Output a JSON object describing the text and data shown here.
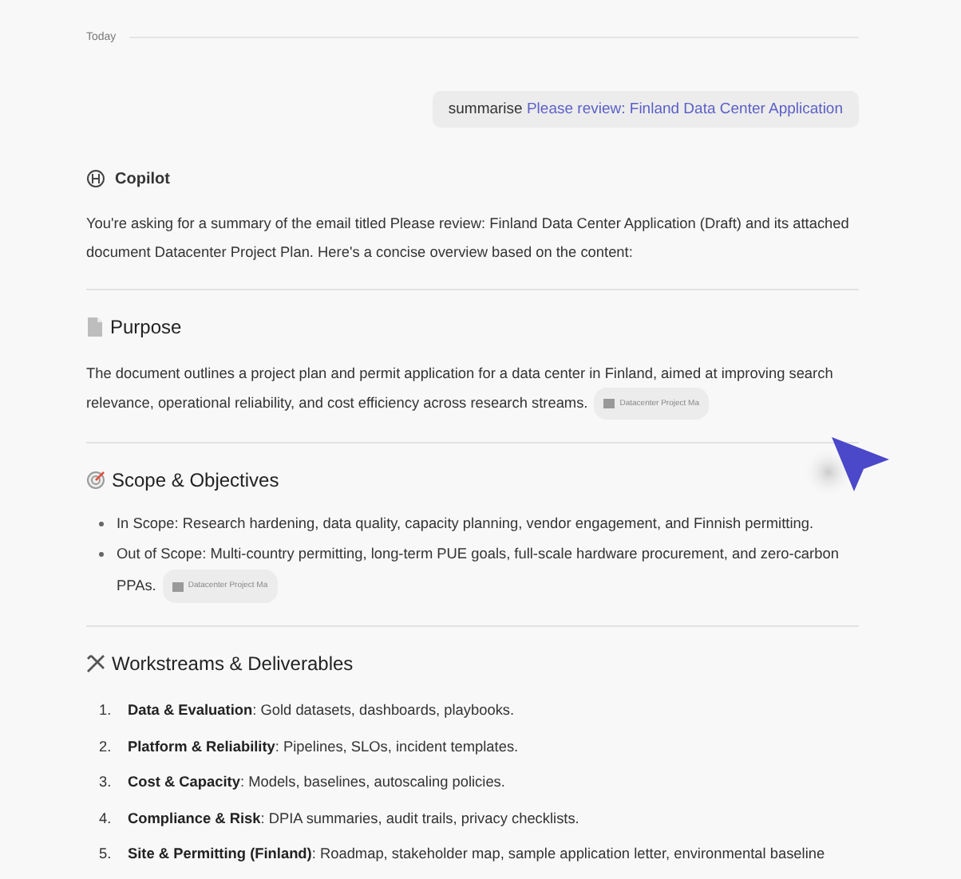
{
  "date_divider": "Today",
  "user_message": {
    "text": "summarise",
    "link": "Please review: Finland Data Center Application"
  },
  "assistant": {
    "name": "Copilot",
    "intro": "You're asking for a summary of the email titled Please review: Finland Data Center Application (Draft) and its attached document Datacenter Project Plan. Here's a concise overview based on the content:",
    "sections": [
      {
        "title": "Purpose",
        "kind": "paragraph",
        "text": "The document outlines a project plan and permit application for a data center in Finland, aimed at improving search relevance, operational reliability, and cost efficiency across research streams.",
        "citation": "Datacenter Project Ma"
      },
      {
        "title": "Scope & Objectives",
        "kind": "bullets",
        "items": [
          {
            "text": "In Scope: Research hardening, data quality, capacity planning, vendor engagement, and Finnish permitting."
          },
          {
            "text": "Out of Scope: Multi-country permitting, long-term PUE goals, full-scale hardware procurement, and zero-carbon PPAs.",
            "citation": "Datacenter Project Ma"
          }
        ]
      },
      {
        "title": "Workstreams & Deliverables",
        "kind": "numbered",
        "items": [
          {
            "number": "1.",
            "text": "**Data & Evaluation**: Gold datasets, dashboards, playbooks."
          },
          {
            "number": "2.",
            "text": "**Platform & Reliability**: Pipelines, SLOs, incident templates."
          },
          {
            "number": "3.",
            "text": "**Cost & Capacity**: Models, baselines, autoscaling policies."
          },
          {
            "number": "4.",
            "text": "**Compliance & Risk**: DPIA summaries, audit trails, privacy checklists."
          },
          {
            "number": "5.",
            "text": "**Site & Permitting (Finland)**: Roadmap, stakeholder map, sample application letter, environmental baseline"
          }
        ]
      }
    ]
  }
}
